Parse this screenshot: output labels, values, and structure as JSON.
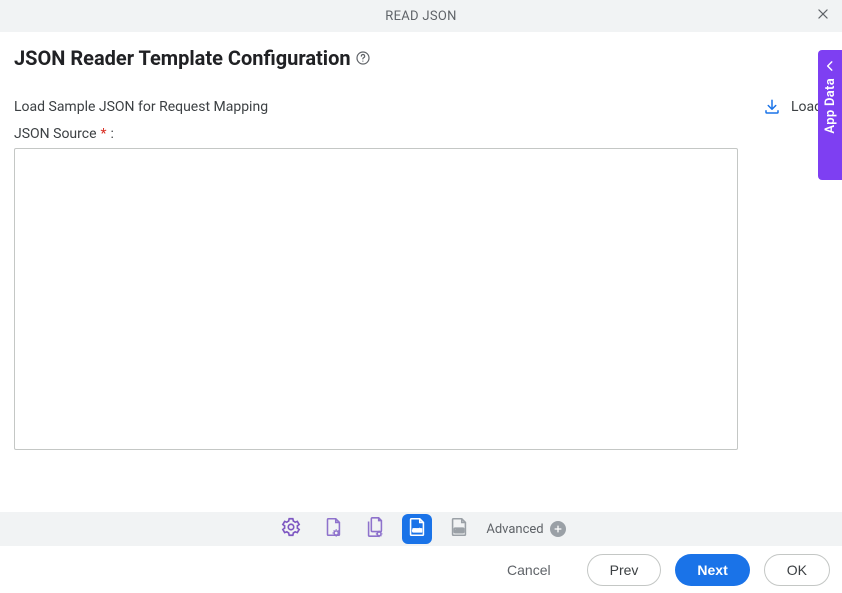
{
  "modal": {
    "title": "READ JSON"
  },
  "page": {
    "title": "JSON Reader Template Configuration",
    "subtitle": "Load Sample JSON for Request Mapping"
  },
  "actions": {
    "load": "Load",
    "advanced": "Advanced",
    "cancel": "Cancel",
    "prev": "Prev",
    "next": "Next",
    "ok": "OK"
  },
  "fields": {
    "json_source_label": "JSON Source",
    "json_source_required": "*",
    "colon": ":",
    "json_source_value": ""
  },
  "sidebar": {
    "app_data": "App Data"
  },
  "icons": {
    "close": "close-icon",
    "help": "help-circle-icon",
    "download": "download-icon",
    "gear": "gear-icon",
    "doc_gear": "document-gear-icon",
    "docs_gear": "documents-gear-icon",
    "json_doc": "json-document-icon",
    "json_doc_alt": "json-document-alt-icon",
    "plus": "plus-icon",
    "chevron_left": "chevron-left-icon"
  }
}
